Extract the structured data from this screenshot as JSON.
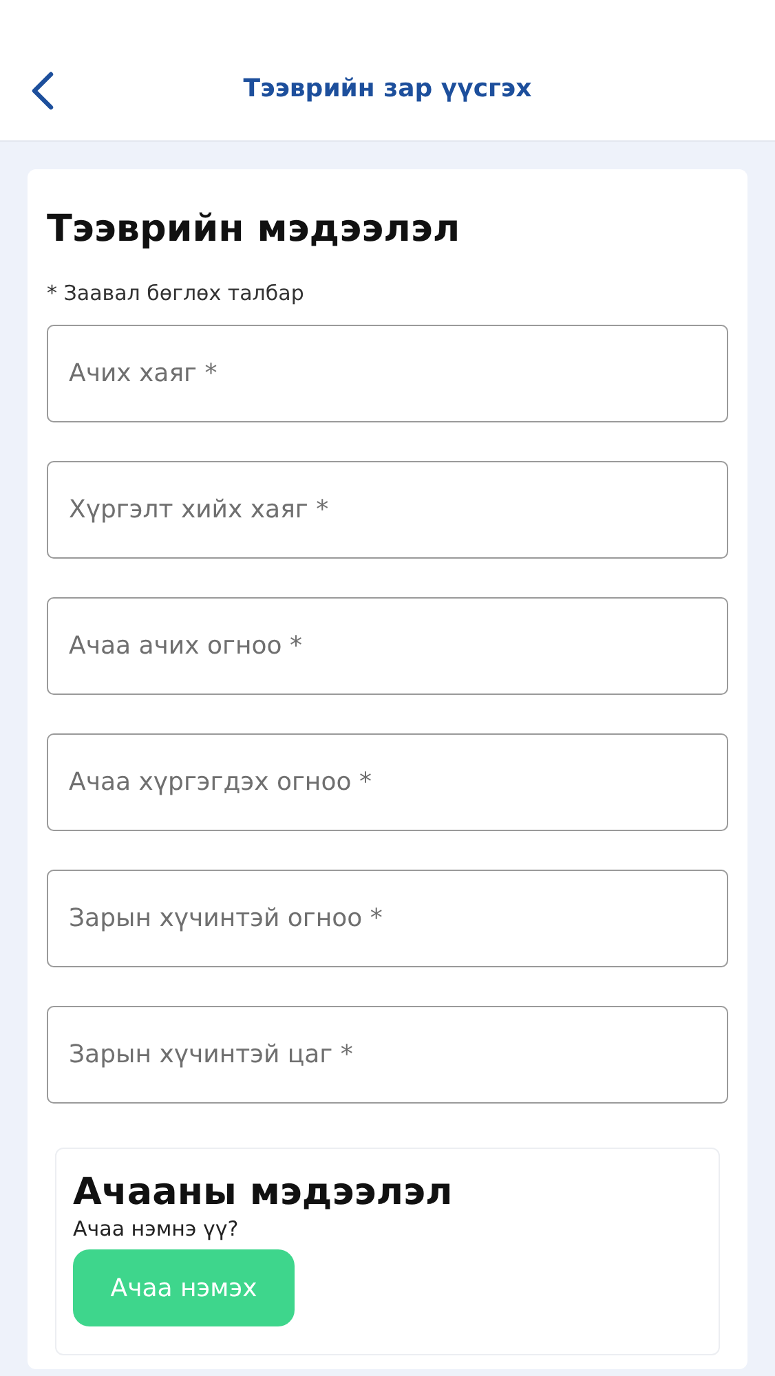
{
  "header": {
    "title": "Тээврийн зар үүсгэх"
  },
  "transport_section": {
    "heading": "Тээврийн мэдээлэл",
    "required_note": "* Заавал бөглөх талбар",
    "fields": [
      {
        "placeholder": "Ачих хаяг *"
      },
      {
        "placeholder": "Хүргэлт хийх хаяг *"
      },
      {
        "placeholder": "Ачаа ачих огноо *"
      },
      {
        "placeholder": "Ачаа хүргэгдэх огноо *"
      },
      {
        "placeholder": "Зарын хүчинтэй огноо *"
      },
      {
        "placeholder": "Зарын хүчинтэй цаг *"
      }
    ]
  },
  "cargo_section": {
    "heading": "Ачааны мэдээлэл",
    "prompt": "Ачаа нэмнэ үү?",
    "button": "Ачаа нэмэх"
  }
}
